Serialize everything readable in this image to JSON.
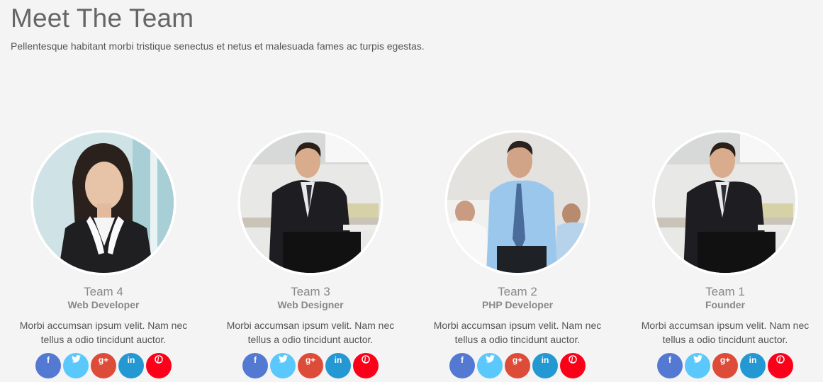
{
  "header": {
    "title": "Meet The Team",
    "subtitle": "Pellentesque habitant morbi tristique senectus et netus et malesuada fames ac turpis egestas."
  },
  "colors": {
    "facebook": "#5479d3",
    "twitter": "#5bc8fc",
    "gplus": "#dd4b39",
    "linkedin": "#2498d3",
    "pinterest": "#fc0019"
  },
  "social_icons": {
    "facebook": "f",
    "twitter": "twitter-bird-icon",
    "gplus": "g+",
    "linkedin": "in",
    "pinterest": "pinterest-icon"
  },
  "team": [
    {
      "name": "Team 4",
      "role": "Web Developer",
      "description": "Morbi accumsan ipsum velit. Nam nec tellus a odio tincidunt auctor.",
      "photo": "woman-in-blazer-photo"
    },
    {
      "name": "Team 3",
      "role": "Web Designer",
      "description": "Morbi accumsan ipsum velit. Nam nec tellus a odio tincidunt auctor.",
      "photo": "man-seated-in-office-photo"
    },
    {
      "name": "Team 2",
      "role": "PHP Developer",
      "description": "Morbi accumsan ipsum velit. Nam nec tellus a odio tincidunt auctor.",
      "photo": "man-in-blue-shirt-photo"
    },
    {
      "name": "Team 1",
      "role": "Founder",
      "description": "Morbi accumsan ipsum velit. Nam nec tellus a odio tincidunt auctor.",
      "photo": "man-seated-in-office-photo"
    }
  ]
}
